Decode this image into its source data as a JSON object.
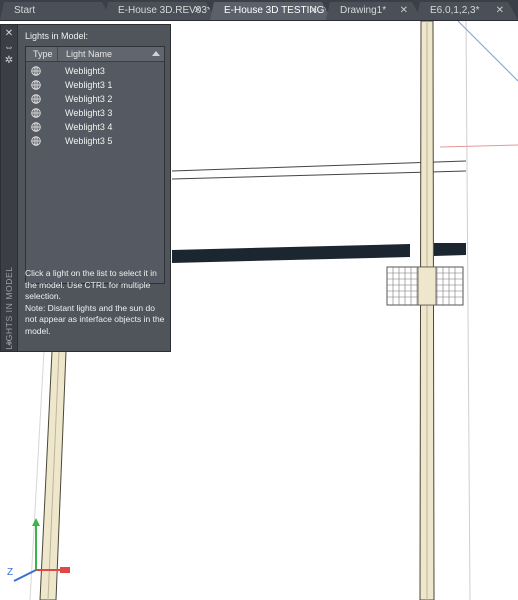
{
  "tabs": [
    {
      "label": "Start",
      "close": ""
    },
    {
      "label": "E-House 3D.REV03*",
      "close": "✕"
    },
    {
      "label": "E-House 3D TESTING*",
      "close": "✕"
    },
    {
      "label": "Drawing1*",
      "close": "✕"
    },
    {
      "label": "E6.0,1,2,3*",
      "close": "✕"
    }
  ],
  "palette": {
    "strip_title": "LIGHTS IN MODEL",
    "strip_icons": [
      "close-icon",
      "pin-icon",
      "properties-icon",
      "bulb-icon"
    ],
    "heading": "Lights in Model:",
    "columns": {
      "type": "Type",
      "name": "Light Name"
    },
    "lights": [
      {
        "name": "Weblight3"
      },
      {
        "name": "Weblight3 1"
      },
      {
        "name": "Weblight3 2"
      },
      {
        "name": "Weblight3 3"
      },
      {
        "name": "Weblight3 4"
      },
      {
        "name": "Weblight3 5"
      }
    ],
    "help_text": "Click a light on the list to select it in the model. Use CTRL for multiple selection.\nNote: Distant lights and the sun do not appear as interface objects in the model."
  },
  "ucs": {
    "z": "Z"
  },
  "colors": {
    "tabbar": "#3b3f47",
    "palette": "#50545b",
    "beam": "#1c2630",
    "post": "#efe7cc"
  }
}
